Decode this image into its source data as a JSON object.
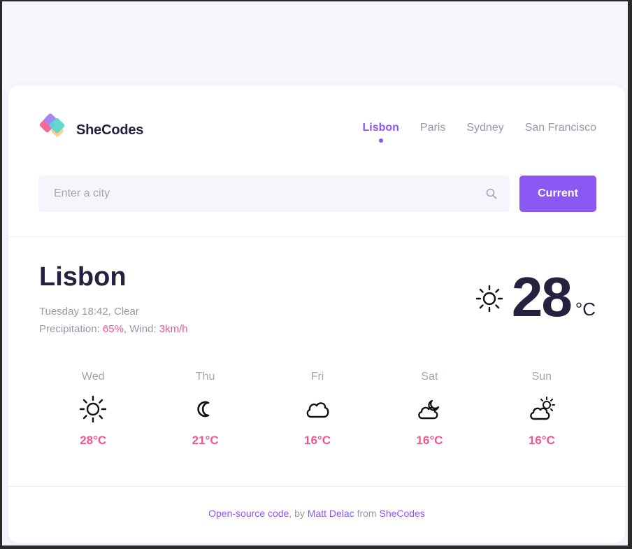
{
  "logo": {
    "text": "SheCodes"
  },
  "nav": {
    "items": [
      {
        "label": "Lisbon",
        "active": true
      },
      {
        "label": "Paris",
        "active": false
      },
      {
        "label": "Sydney",
        "active": false
      },
      {
        "label": "San Francisco",
        "active": false
      }
    ]
  },
  "search": {
    "placeholder": "Enter a city",
    "value": "",
    "icon": "search-icon"
  },
  "current_button": {
    "label": "Current"
  },
  "weather": {
    "city": "Lisbon",
    "datetime_condition": "Tuesday 18:42, Clear",
    "precipitation_label": "Precipitation:",
    "precipitation_value": "65%",
    "wind_label": "Wind:",
    "wind_value": "3km/h",
    "temperature": "28",
    "unit": "°C",
    "icon": "sun-icon"
  },
  "forecast": [
    {
      "day": "Wed",
      "temp": "28°C",
      "icon": "sun-icon"
    },
    {
      "day": "Thu",
      "temp": "21°C",
      "icon": "moon-icon"
    },
    {
      "day": "Fri",
      "temp": "16°C",
      "icon": "cloud-icon"
    },
    {
      "day": "Sat",
      "temp": "16°C",
      "icon": "cloud-moon-icon"
    },
    {
      "day": "Sun",
      "temp": "16°C",
      "icon": "cloud-sun-icon"
    }
  ],
  "footer": {
    "source_link": "Open-source code",
    "by_text": ", by ",
    "author_link": "Matt Delac",
    "from_text": " from ",
    "org_link": "SheCodes"
  },
  "colors": {
    "accent": "#8c58f3",
    "pink": "#f0578b",
    "dark": "#27213f",
    "muted": "#9a96aa",
    "background": "#f7f6fd"
  }
}
